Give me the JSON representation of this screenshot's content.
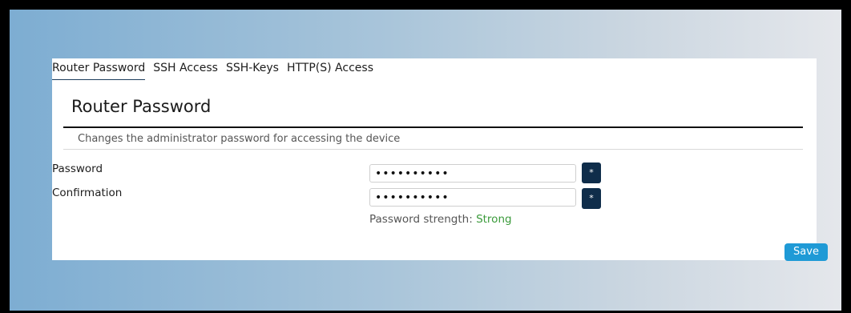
{
  "tabs": [
    {
      "label": "Router Password",
      "active": true
    },
    {
      "label": "SSH Access",
      "active": false
    },
    {
      "label": "SSH-Keys",
      "active": false
    },
    {
      "label": "HTTP(S) Access",
      "active": false
    }
  ],
  "section": {
    "title": "Router Password",
    "description": "Changes the administrator password for accessing the device"
  },
  "fields": {
    "password": {
      "label": "Password",
      "value": "••••••••••",
      "reveal_icon": "asterisk-icon",
      "reveal_label": "*"
    },
    "confirmation": {
      "label": "Confirmation",
      "value": "••••••••••",
      "reveal_icon": "asterisk-icon",
      "reveal_label": "*"
    }
  },
  "strength": {
    "label": "Password strength:",
    "value": "Strong",
    "color": "#3a9a3a"
  },
  "actions": {
    "save_label": "Save",
    "save_color": "#1f9ad6"
  },
  "colors": {
    "reveal_button": "#0f2d4a"
  }
}
